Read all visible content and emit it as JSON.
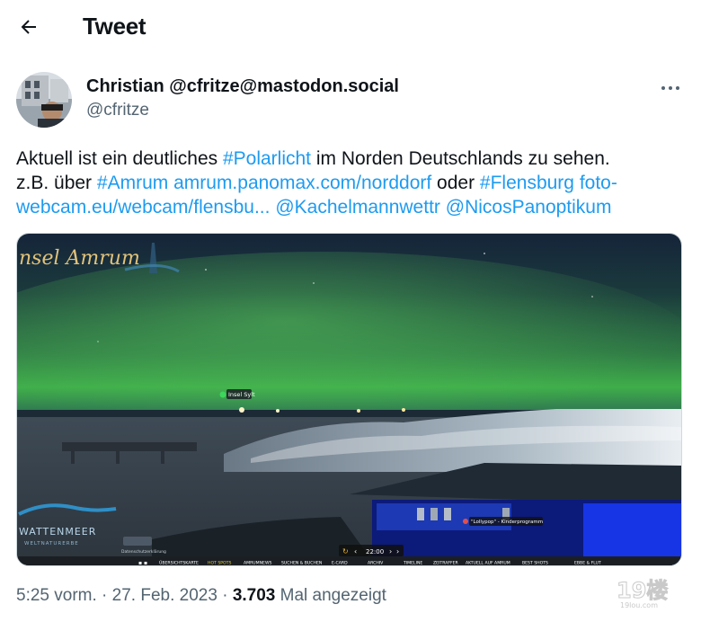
{
  "header": {
    "title": "Tweet",
    "back_icon": "arrow-left-icon"
  },
  "author": {
    "display_name": "Christian @cfritze@mastodon.social",
    "handle": "@cfritze",
    "more_icon": "ellipsis-icon"
  },
  "tweet": {
    "l1_t1": "Aktuell ist ein deutliches ",
    "l1_tag": "#Polarlicht",
    "l1_t2": " im Norden Deutschlands zu sehen.",
    "l2_t1": "z.B. über ",
    "l2_tag1": "#Amrum",
    "l2_sp1": " ",
    "l2_link1": "amrum.panomax.com/norddorf",
    "l2_t2": " oder ",
    "l2_tag2": "#Flensburg",
    "l2_sp2": " ",
    "l2_link2a": "foto-",
    "l3_link2b": "webcam.eu/webcam/flensbu...",
    "l3_sp1": " ",
    "l3_mention1": "@Kachelmannwettr",
    "l3_sp2": " ",
    "l3_mention2": "@NicosPanoptikum",
    "link_color": "#1d9bf0"
  },
  "media": {
    "overlay_title": "nsel Amrum",
    "poi_label": "Insel Sylt",
    "poi2_label": "\"Lollypop\" - Kinderprogramm",
    "logo_text": "WATTENMEER",
    "logo_sub": "WELTNATURERBE",
    "small_label": "Datenschutzerklärung",
    "time": "22:00",
    "nav_items": [
      "ÜBERSICHTSKARTE",
      "HOT SPOTS",
      "AMRUMNEWS",
      "SUCHEN & BUCHEN",
      "E-CARD",
      "ARCHIV",
      "TIMELINE",
      "ZEITRAFFER",
      "AKTUELL AUF AMRUM",
      "BEST SHOTS",
      "EBBE & FLUT"
    ],
    "aurora_color": "#3fae4a",
    "building_light_color": "#1a3cff"
  },
  "meta": {
    "time": "5:25 vorm.",
    "sep1": " · ",
    "date": "27. Feb. 2023",
    "sep2": " · ",
    "views": "3.703",
    "views_label": " Mal angezeigt"
  },
  "watermark": {
    "text": "19楼",
    "sub": "19lou.com"
  }
}
